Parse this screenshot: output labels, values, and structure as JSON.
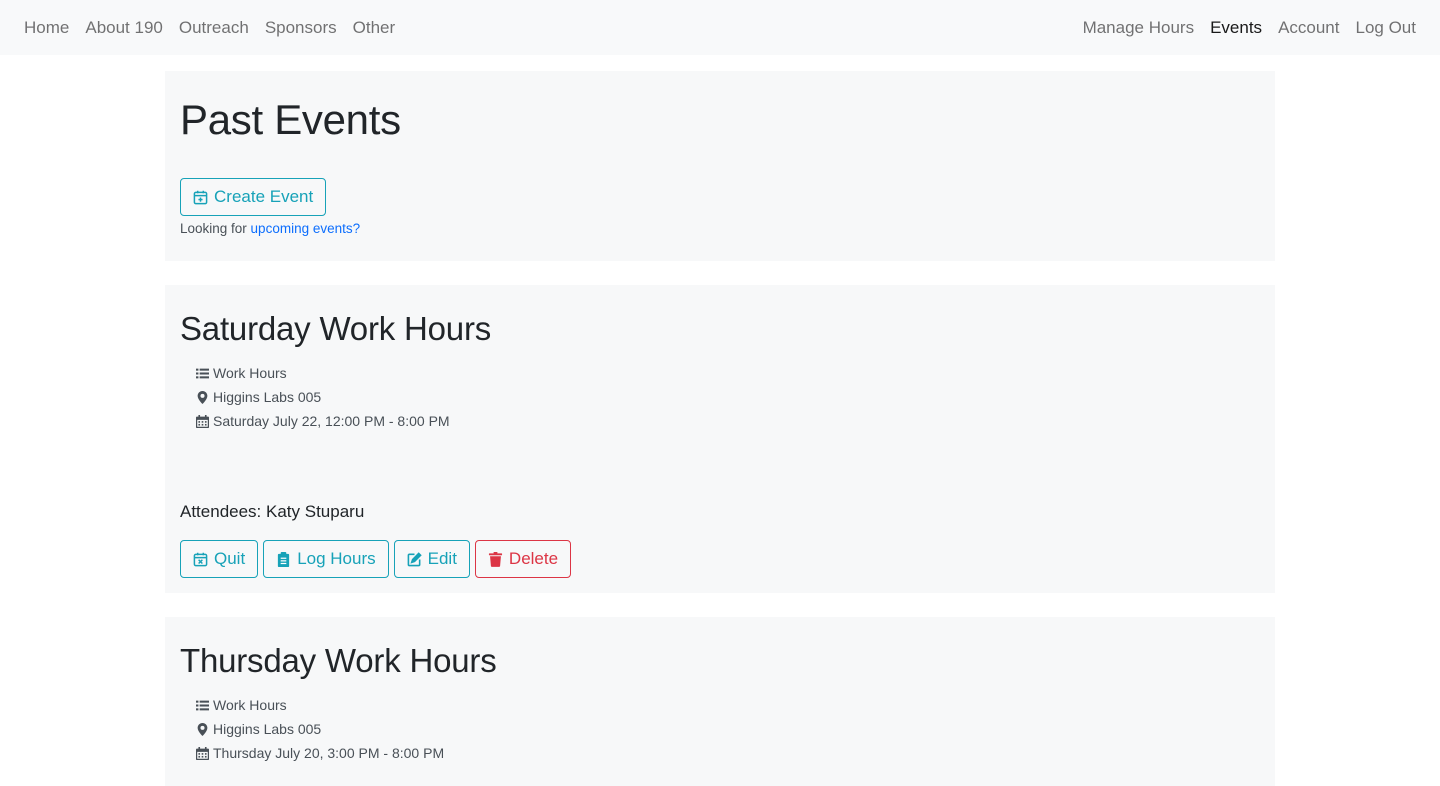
{
  "nav": {
    "left": [
      "Home",
      "About 190",
      "Outreach",
      "Sponsors",
      "Other"
    ],
    "right": [
      "Manage Hours",
      "Events",
      "Account",
      "Log Out"
    ],
    "active": "Events"
  },
  "header": {
    "title": "Past Events",
    "create_label": "Create Event",
    "looking_prefix": "Looking for ",
    "looking_link": "upcoming events?"
  },
  "events": [
    {
      "title": "Saturday Work Hours",
      "category": "Work Hours",
      "location": "Higgins Labs 005",
      "datetime": "Saturday July 22, 12:00 PM - 8:00 PM",
      "attendees": "Attendees: Katy Stuparu",
      "actions": {
        "quit": "Quit",
        "log_hours": "Log Hours",
        "edit": "Edit",
        "delete": "Delete"
      }
    },
    {
      "title": "Thursday Work Hours",
      "category": "Work Hours",
      "location": "Higgins Labs 005",
      "datetime": "Thursday July 20, 3:00 PM - 8:00 PM"
    }
  ],
  "colors": {
    "info": "#17a2b8",
    "danger": "#dc3545",
    "link": "#0d6efd",
    "panel": "#f7f8f9",
    "navbar": "#f8f9fa"
  },
  "icons": {
    "create": "calendar-plus-icon",
    "category": "list-icon",
    "location": "map-marker-icon",
    "date": "calendar-icon",
    "quit": "calendar-x-icon",
    "log_hours": "clipboard-icon",
    "edit": "edit-icon",
    "delete": "trash-icon"
  }
}
